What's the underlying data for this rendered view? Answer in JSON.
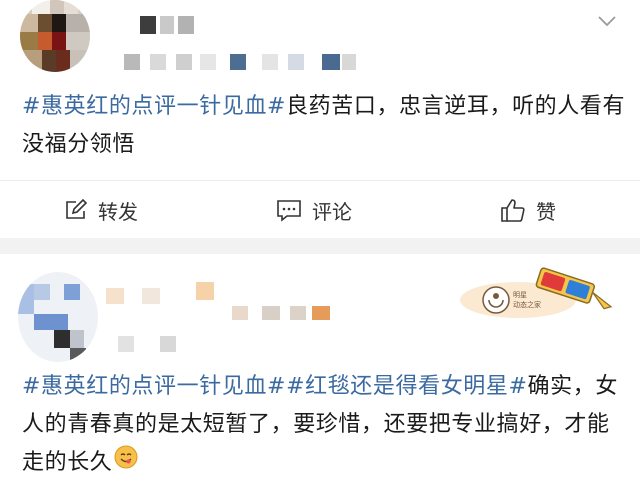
{
  "post1": {
    "hashtag": "#惠英红的点评一针见血#",
    "content": "良药苦口，忠言逆耳，听的人看有没福分领悟"
  },
  "actions": {
    "repost_label": "转发",
    "comment_label": "评论",
    "like_label": "赞",
    "repost_icon": "repost-icon",
    "comment_icon": "comment-icon",
    "like_icon": "thumbs-up-icon"
  },
  "post2": {
    "hashtag1": "#惠英红的点评一针见血#",
    "hashtag2": "#红毯还是得看女明星#",
    "content": "确实，女人的青春真的是太短暂了，要珍惜，还要把专业搞好，才能走的长久",
    "emoji": "yum-face-emoji",
    "sticker": "3d-glasses-sticker"
  },
  "colors": {
    "hashtag": "#3b6aa0",
    "text": "#1a1a1a",
    "background": "#f2f2f2"
  }
}
